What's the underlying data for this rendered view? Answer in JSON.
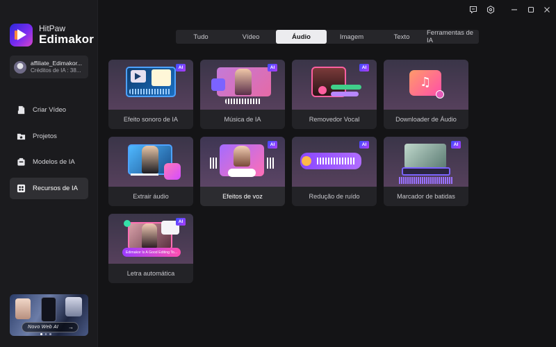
{
  "app": {
    "brand_line1": "HitPaw",
    "brand_line2": "Edimakor"
  },
  "account": {
    "name": "affiliate_Edimakor...",
    "credits": "Créditos de IA : 38..."
  },
  "sidebar": {
    "items": [
      {
        "label": "Criar Vídeo",
        "icon": "video-file-icon",
        "active": false
      },
      {
        "label": "Projetos",
        "icon": "folder-star-icon",
        "active": false
      },
      {
        "label": "Modelos de IA",
        "icon": "template-box-icon",
        "active": false
      },
      {
        "label": "Recursos de IA",
        "icon": "film-reel-icon",
        "active": true
      }
    ],
    "promo_label": "Novo Web AI",
    "promo_arrow": "→"
  },
  "tabs": [
    {
      "label": "Tudo",
      "active": false
    },
    {
      "label": "Vídeo",
      "active": false
    },
    {
      "label": "Áudio",
      "active": true
    },
    {
      "label": "Imagem",
      "active": false
    },
    {
      "label": "Texto",
      "active": false
    },
    {
      "label": "Ferramentas de IA",
      "active": false
    }
  ],
  "cards": [
    {
      "label": "Efeito sonoro de IA",
      "ai": true
    },
    {
      "label": "Música de IA",
      "ai": true
    },
    {
      "label": "Removedor Vocal",
      "ai": true
    },
    {
      "label": "Downloader de Áudio",
      "ai": false
    },
    {
      "label": "Extrair áudio",
      "ai": false
    },
    {
      "label": "Efeitos de voz",
      "ai": true
    },
    {
      "label": "Redução de ruído",
      "ai": true
    },
    {
      "label": "Marcador de batidas",
      "ai": true
    },
    {
      "label": "Letra automática",
      "ai": true
    }
  ],
  "ai_badge": "AI",
  "lyric_snippet": "Edimakor Is A Good Editing To...",
  "colors": {
    "accent_purple": "#8a3cff",
    "accent_pink": "#ff4fb0",
    "badge_start": "#3b4dff",
    "badge_end": "#b13cff"
  }
}
